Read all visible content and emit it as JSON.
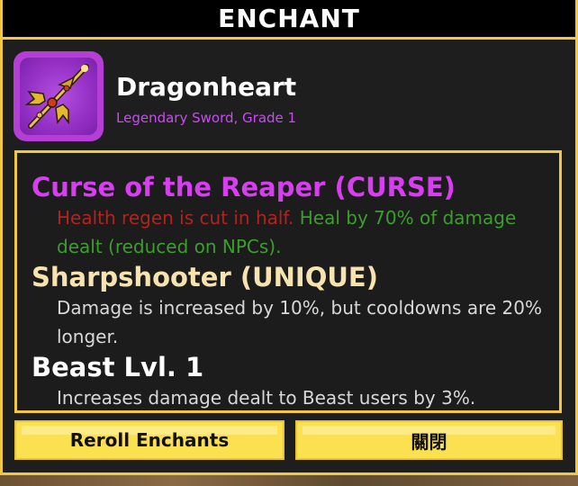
{
  "window": {
    "title": "ENCHANT"
  },
  "item": {
    "name": "Dragonheart",
    "subtitle": "Legendary Sword, Grade 1",
    "icon": "sword-icon",
    "rarity_color": "#b53fd6"
  },
  "enchants": [
    {
      "title": "Curse of the Reaper (CURSE)",
      "title_color": "#d63ef0",
      "desc_negative": "Health regen is cut in half.",
      "desc_positive": "Heal by 70% of damage dealt (reduced on NPCs)."
    },
    {
      "title": "Sharpshooter (UNIQUE)",
      "title_color": "#f6e3b0",
      "desc": "Damage is increased by 10%, but cooldowns are 20% longer."
    },
    {
      "title": "Beast Lvl. 1",
      "title_color": "#ffffff",
      "desc": "Increases damage dealt to Beast users by 3%."
    }
  ],
  "buttons": {
    "reroll_label": "Reroll Enchants",
    "close_label": "關閉"
  },
  "colors": {
    "accent": "#f2c744",
    "button": "#fbe04f",
    "negative": "#b4221e",
    "positive": "#3c9e2e"
  }
}
